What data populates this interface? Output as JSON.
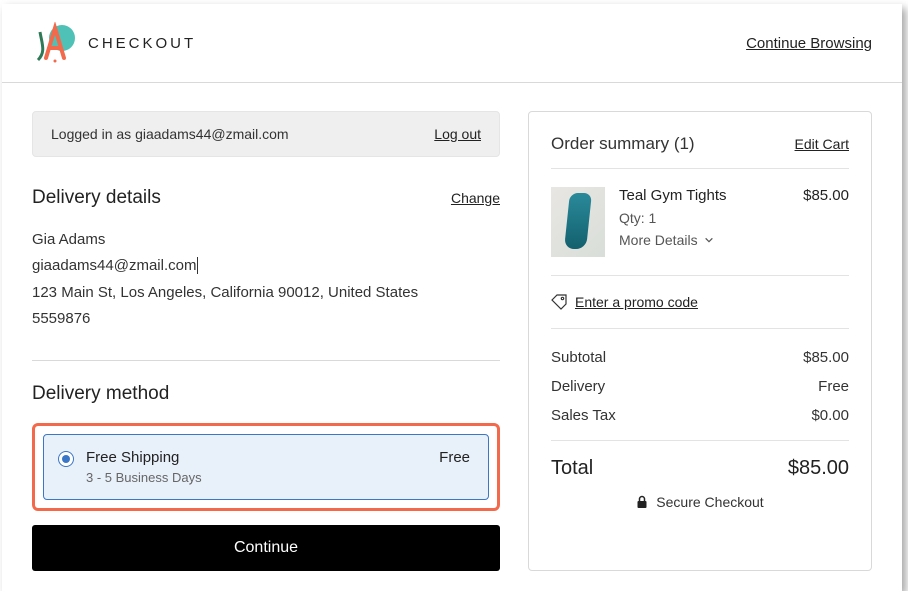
{
  "header": {
    "title": "CHECKOUT",
    "continue_link": "Continue Browsing"
  },
  "login": {
    "prefix": "Logged in as ",
    "email": "giaadams44@zmail.com",
    "logout": "Log out"
  },
  "delivery": {
    "title": "Delivery details",
    "change": "Change",
    "name": "Gia Adams",
    "email": "giaadams44@zmail.com",
    "address": "123 Main St, Los Angeles, California 90012, United States",
    "phone": "5559876"
  },
  "method": {
    "title": "Delivery method",
    "option": {
      "label": "Free Shipping",
      "sub": "3 - 5 Business Days",
      "price": "Free"
    },
    "continue_btn": "Continue"
  },
  "summary": {
    "title_prefix": "Order summary",
    "count": "(1)",
    "edit": "Edit Cart",
    "item": {
      "name": "Teal Gym Tights",
      "qty": "Qty: 1",
      "more": "More Details",
      "price": "$85.00"
    },
    "promo": "Enter a promo code",
    "lines": {
      "subtotal_label": "Subtotal",
      "subtotal_value": "$85.00",
      "delivery_label": "Delivery",
      "delivery_value": "Free",
      "tax_label": "Sales Tax",
      "tax_value": "$0.00"
    },
    "total_label": "Total",
    "total_value": "$85.00",
    "secure": "Secure Checkout"
  }
}
